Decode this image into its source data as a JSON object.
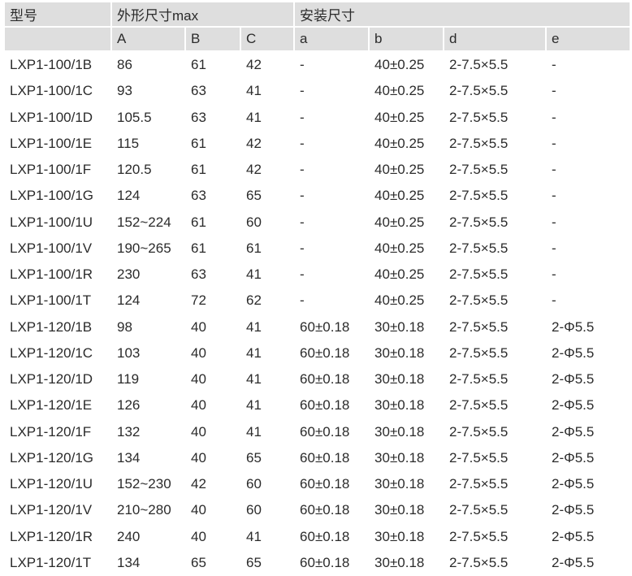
{
  "header": {
    "model": "型号",
    "outer_group": "外形尺寸max",
    "mount_group": "安装尺寸",
    "columns": [
      "A",
      "B",
      "C",
      "a",
      "b",
      "d",
      "e"
    ]
  },
  "rows": [
    [
      "LXP1-100/1B",
      "86",
      "61",
      "42",
      "-",
      "40±0.25",
      "2-7.5×5.5",
      "-"
    ],
    [
      "LXP1-100/1C",
      "93",
      "63",
      "41",
      "-",
      "40±0.25",
      "2-7.5×5.5",
      "-"
    ],
    [
      "LXP1-100/1D",
      "105.5",
      "63",
      "41",
      "-",
      "40±0.25",
      "2-7.5×5.5",
      "-"
    ],
    [
      "LXP1-100/1E",
      "115",
      "61",
      "42",
      "-",
      "40±0.25",
      "2-7.5×5.5",
      "-"
    ],
    [
      "LXP1-100/1F",
      "120.5",
      "61",
      "42",
      "-",
      "40±0.25",
      "2-7.5×5.5",
      "-"
    ],
    [
      "LXP1-100/1G",
      "124",
      "63",
      "65",
      "-",
      "40±0.25",
      "2-7.5×5.5",
      "-"
    ],
    [
      "LXP1-100/1U",
      "152~224",
      "61",
      "60",
      "-",
      "40±0.25",
      "2-7.5×5.5",
      "-"
    ],
    [
      "LXP1-100/1V",
      "190~265",
      "61",
      "61",
      "-",
      "40±0.25",
      "2-7.5×5.5",
      "-"
    ],
    [
      "LXP1-100/1R",
      "230",
      "63",
      "41",
      "-",
      "40±0.25",
      "2-7.5×5.5",
      "-"
    ],
    [
      "LXP1-100/1T",
      "124",
      "72",
      "62",
      "-",
      "40±0.25",
      "2-7.5×5.5",
      "-"
    ],
    [
      "LXP1-120/1B",
      "98",
      "40",
      "41",
      "60±0.18",
      "30±0.18",
      "2-7.5×5.5",
      "2-Φ5.5"
    ],
    [
      "LXP1-120/1C",
      "103",
      "40",
      "41",
      "60±0.18",
      "30±0.18",
      "2-7.5×5.5",
      "2-Φ5.5"
    ],
    [
      "LXP1-120/1D",
      "119",
      "40",
      "41",
      "60±0.18",
      "30±0.18",
      "2-7.5×5.5",
      "2-Φ5.5"
    ],
    [
      "LXP1-120/1E",
      "126",
      "40",
      "41",
      "60±0.18",
      "30±0.18",
      "2-7.5×5.5",
      "2-Φ5.5"
    ],
    [
      "LXP1-120/1F",
      "132",
      "40",
      "41",
      "60±0.18",
      "30±0.18",
      "2-7.5×5.5",
      "2-Φ5.5"
    ],
    [
      "LXP1-120/1G",
      "134",
      "40",
      "65",
      "60±0.18",
      "30±0.18",
      "2-7.5×5.5",
      "2-Φ5.5"
    ],
    [
      "LXP1-120/1U",
      "152~230",
      "42",
      "60",
      "60±0.18",
      "30±0.18",
      "2-7.5×5.5",
      "2-Φ5.5"
    ],
    [
      "LXP1-120/1V",
      "210~280",
      "40",
      "60",
      "60±0.18",
      "30±0.18",
      "2-7.5×5.5",
      "2-Φ5.5"
    ],
    [
      "LXP1-120/1R",
      "240",
      "40",
      "41",
      "60±0.18",
      "30±0.18",
      "2-7.5×5.5",
      "2-Φ5.5"
    ],
    [
      "LXP1-120/1T",
      "134",
      "65",
      "65",
      "60±0.18",
      "30±0.18",
      "2-7.5×5.5",
      "2-Φ5.5"
    ]
  ]
}
